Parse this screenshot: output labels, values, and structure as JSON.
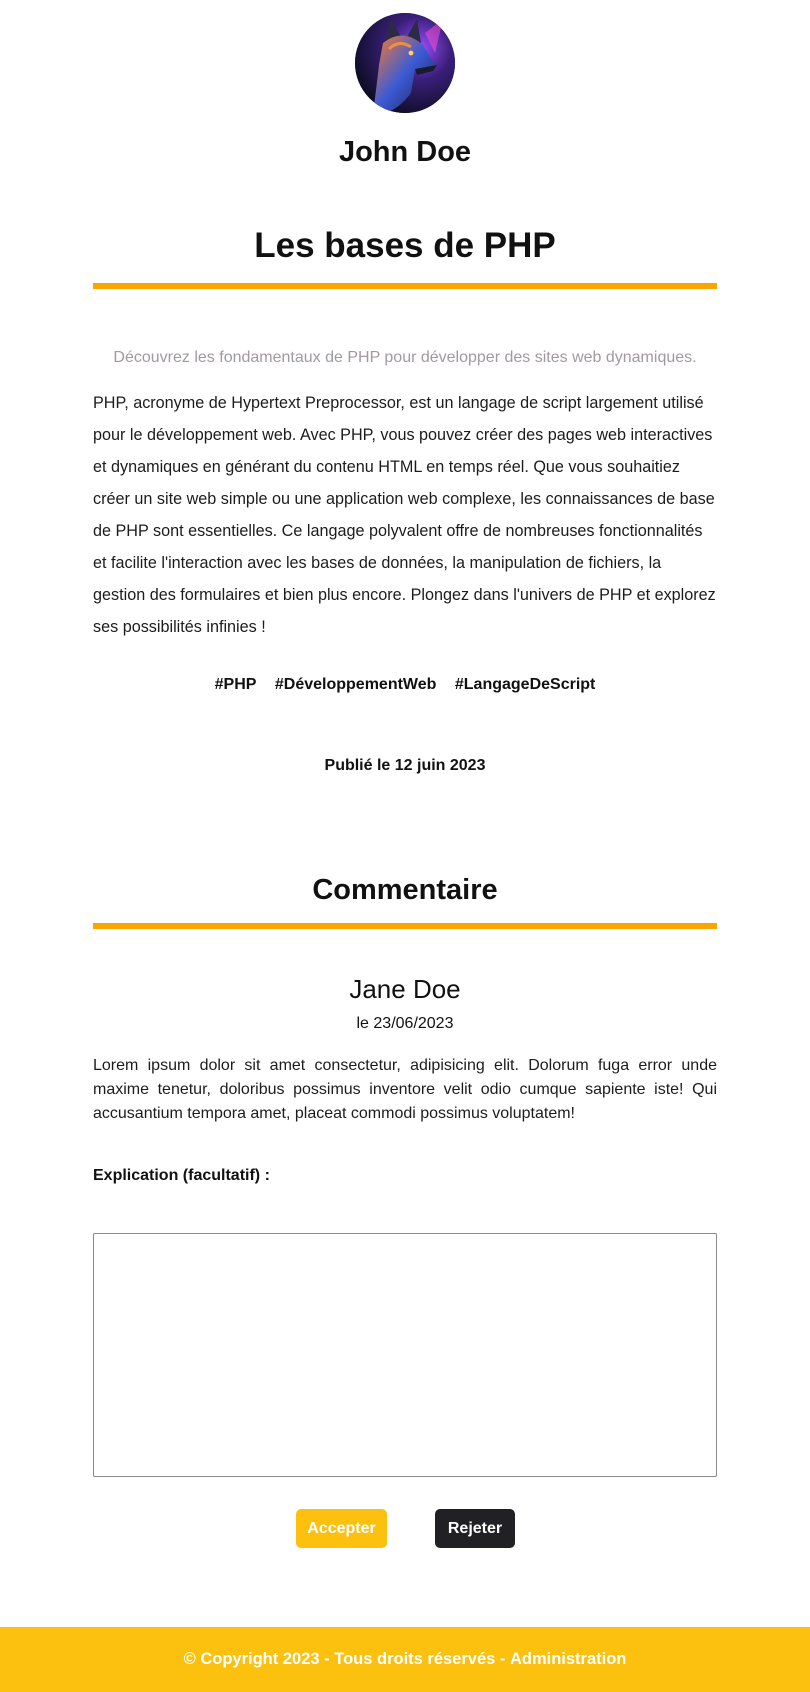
{
  "profile": {
    "avatar_icon": "wolf-avatar-icon",
    "name": "John Doe"
  },
  "article": {
    "title": "Les bases de PHP",
    "subtitle": "Découvrez les fondamentaux de PHP pour développer des sites web dynamiques.",
    "body": "PHP, acronyme de Hypertext Preprocessor, est un langage de script largement utilisé pour le développement web. Avec PHP, vous pouvez créer des pages web interactives et dynamiques en générant du contenu HTML en temps réel. Que vous souhaitiez créer un site web simple ou une application web complexe, les connaissances de base de PHP sont essentielles. Ce langage polyvalent offre de nombreuses fonctionnalités et facilite l'interaction avec les bases de données, la manipulation de fichiers, la gestion des formulaires et bien plus encore. Plongez dans l'univers de PHP et explorez ses possibilités infinies !",
    "hashtags": [
      "#PHP",
      "#DéveloppementWeb",
      "#LangageDeScript"
    ],
    "published": "Publié le 12 juin 2023"
  },
  "comments": {
    "title": "Commentaire",
    "author": "Jane Doe",
    "date": "le 23/06/2023",
    "text": "Lorem ipsum dolor sit amet consectetur, adipisicing elit. Dolorum fuga error unde maxime tenetur, doloribus possimus inventore velit odio cumque sapiente iste! Qui accusantium tempora amet, placeat commodi possimus voluptatem!"
  },
  "form": {
    "explication_label": "Explication (facultatif) :",
    "explication_value": "",
    "accept_label": "Accepter",
    "reject_label": "Rejeter"
  },
  "footer": {
    "copyright": "© Copyright 2023 - Tous droits réservés - ",
    "admin_link": "Administration"
  },
  "colors": {
    "accent_orange": "#f9a602",
    "accept_yellow": "#fcc00e",
    "reject_dark": "#212125",
    "footer_bg": "#fcc00e",
    "subtitle_gray": "#a09aa0"
  }
}
